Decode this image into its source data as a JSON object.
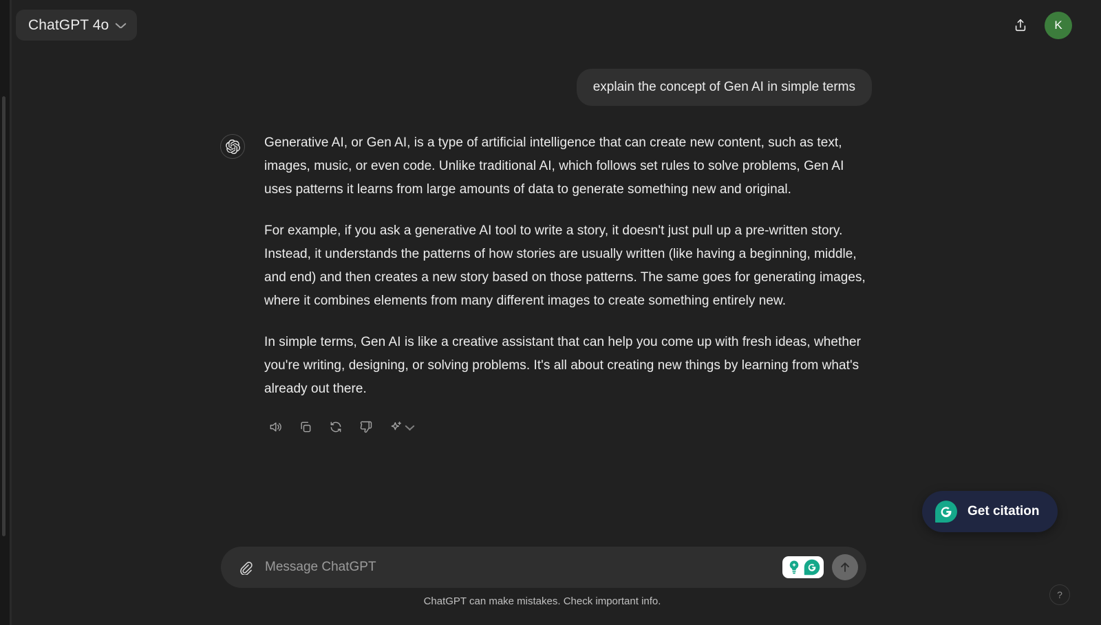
{
  "app": {
    "background_color": "#212121",
    "accent_green": "#3c7d3c",
    "grammarly_teal": "#15a88a",
    "citation_bg": "#1f2641"
  },
  "topbar": {
    "model_label": "ChatGPT 4o",
    "chevron_icon": "chevron-down-icon",
    "share_icon": "share-upload-icon",
    "avatar_initial": "K"
  },
  "conversation": {
    "user_message": "explain the concept of Gen AI in simple terms",
    "assistant": {
      "avatar_icon": "openai-logo-icon",
      "paragraphs": [
        "Generative AI, or Gen AI, is a type of artificial intelligence that can create new content, such as text, images, music, or even code. Unlike traditional AI, which follows set rules to solve problems, Gen AI uses patterns it learns from large amounts of data to generate something new and original.",
        "For example, if you ask a generative AI tool to write a story, it doesn't just pull up a pre-written story. Instead, it understands the patterns of how stories are usually written (like having a beginning, middle, and end) and then creates a new story based on those patterns. The same goes for generating images, where it combines elements from many different images to create something entirely new.",
        "In simple terms, Gen AI is like a creative assistant that can help you come up with fresh ideas, whether you're writing, designing, or solving problems. It's all about creating new things by learning from what's already out there."
      ],
      "actions": [
        {
          "name": "read-aloud",
          "icon": "speaker-icon"
        },
        {
          "name": "copy",
          "icon": "copy-icon"
        },
        {
          "name": "regenerate",
          "icon": "refresh-icon"
        },
        {
          "name": "dislike",
          "icon": "thumbs-down-icon"
        },
        {
          "name": "switch-model",
          "icon": "sparkle-icon"
        }
      ]
    }
  },
  "get_citation": {
    "label": "Get citation",
    "icon": "grammarly-g-icon"
  },
  "composer": {
    "attach_icon": "paperclip-icon",
    "placeholder": "Message ChatGPT",
    "value": "",
    "badges": [
      {
        "name": "grammarly-idea-badge",
        "icon": "lightbulb-icon"
      },
      {
        "name": "grammarly-badge",
        "icon": "grammarly-g-icon"
      }
    ],
    "send_icon": "arrow-up-icon"
  },
  "footer": {
    "disclaimer": "ChatGPT can make mistakes. Check important info.",
    "help_label": "?"
  }
}
